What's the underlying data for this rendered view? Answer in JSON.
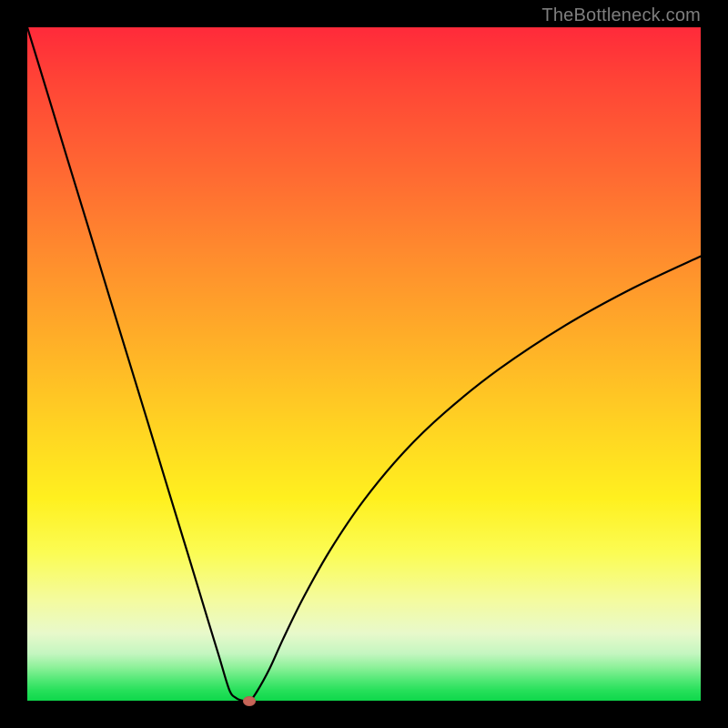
{
  "watermark": "TheBottleneck.com",
  "colors": {
    "curve_stroke": "#000000",
    "marker_fill": "#c76558",
    "frame_bg": "#000000"
  },
  "chart_data": {
    "type": "line",
    "title": "",
    "xlabel": "",
    "ylabel": "",
    "xlim": [
      0,
      100
    ],
    "ylim": [
      0,
      100
    ],
    "grid": false,
    "legend": false,
    "series": [
      {
        "name": "bottleneck-curve",
        "x": [
          0,
          3,
          6,
          9,
          12,
          15,
          18,
          21,
          24,
          27,
          28.5,
          30,
          31,
          32,
          33,
          34,
          36,
          38,
          41,
          45,
          50,
          56,
          62,
          70,
          80,
          90,
          100
        ],
        "y": [
          100,
          90.2,
          80.3,
          70.5,
          60.6,
          50.8,
          41.0,
          31.1,
          21.3,
          11.4,
          6.5,
          1.6,
          0.4,
          0.0,
          0.0,
          1.2,
          4.8,
          9.2,
          15.3,
          22.4,
          29.8,
          37.0,
          42.8,
          49.2,
          55.8,
          61.3,
          66.0
        ]
      }
    ],
    "annotations": {
      "marker": {
        "x": 33,
        "y": 0
      }
    }
  }
}
